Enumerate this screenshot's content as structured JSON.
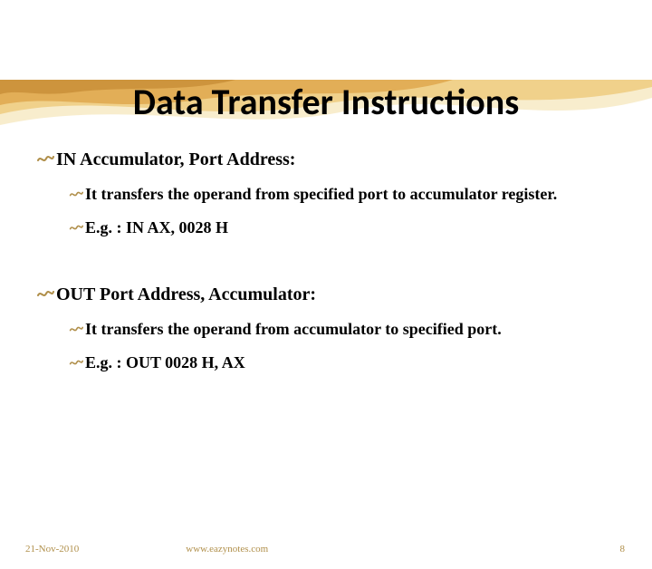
{
  "title": "Data Transfer Instructions",
  "sections": [
    {
      "heading": "IN Accumulator, Port Address:",
      "items": [
        "It transfers the operand from specified port to accumulator register.",
        "E.g. : IN AX, 0028 H"
      ]
    },
    {
      "heading": "OUT Port Address, Accumulator:",
      "items": [
        "It transfers the operand from accumulator to specified port.",
        "E.g. : OUT 0028 H, AX"
      ]
    }
  ],
  "footer": {
    "date": "21-Nov-2010",
    "url": "www.eazynotes.com",
    "page": "8"
  },
  "colors": {
    "accent": "#b08f4a",
    "wave_light": "#f5d98a",
    "wave_mid": "#e8b860",
    "wave_dark": "#d9a648"
  }
}
